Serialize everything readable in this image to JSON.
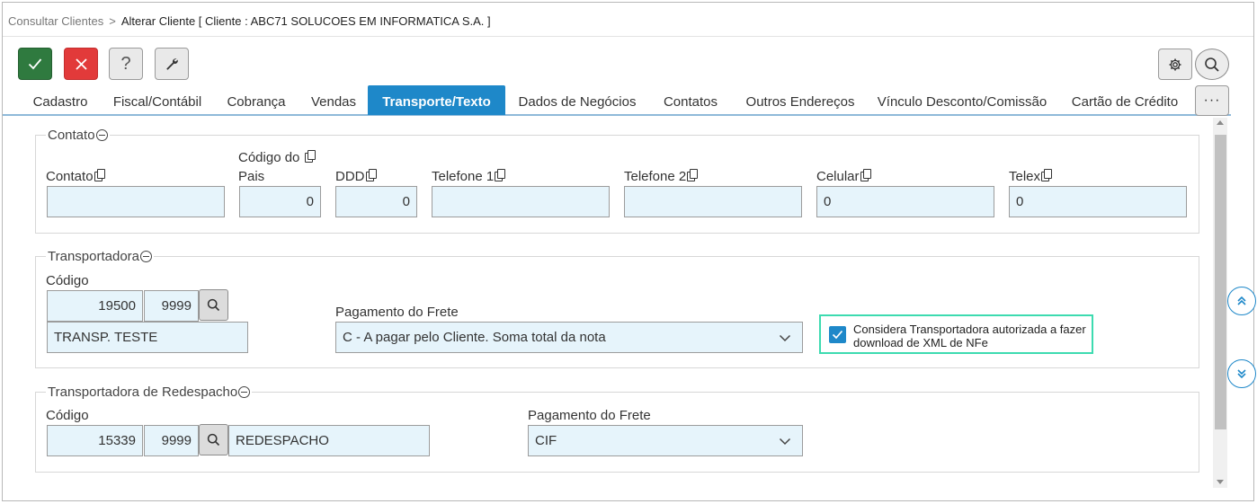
{
  "breadcrumb": {
    "previous": "Consultar Clientes",
    "separator": ">",
    "current": "Alterar Cliente [ Cliente : ABC71 SOLUCOES EM INFORMATICA S.A. ]"
  },
  "toolbar": {
    "help_label": "?",
    "more_label": "···"
  },
  "tabs": [
    {
      "label": "Cadastro",
      "active": false
    },
    {
      "label": "Fiscal/Contábil",
      "active": false
    },
    {
      "label": "Cobrança",
      "active": false
    },
    {
      "label": "Vendas",
      "active": false
    },
    {
      "label": "Transporte/Texto",
      "active": true
    },
    {
      "label": "Dados de Negócios",
      "active": false
    },
    {
      "label": "Contatos",
      "active": false
    },
    {
      "label": "Outros Endereços",
      "active": false
    },
    {
      "label": "Vínculo Desconto/Comissão",
      "active": false
    },
    {
      "label": "Cartão de Crédito",
      "active": false
    }
  ],
  "contato": {
    "legend": "Contato",
    "fields": {
      "contato": {
        "label": "Contato",
        "value": ""
      },
      "codigo_pais": {
        "label_line1": "Código do",
        "label_line2": "Pais",
        "value": "0"
      },
      "ddd": {
        "label": "DDD",
        "value": "0"
      },
      "telefone1": {
        "label": "Telefone 1",
        "value": ""
      },
      "telefone2": {
        "label": "Telefone 2",
        "value": ""
      },
      "celular": {
        "label": "Celular",
        "value": "0"
      },
      "telex": {
        "label": "Telex",
        "value": "0"
      }
    }
  },
  "transportadora": {
    "legend": "Transportadora",
    "codigo_label": "Código",
    "codigo": "19500",
    "codigo_filial": "9999",
    "nome": "TRANSP. TESTE",
    "pagamento_label": "Pagamento do Frete",
    "pagamento_value": "C - A pagar pelo Cliente. Soma total da nota",
    "checkbox_label": "Considera Transportadora autorizada a fazer download de XML de NFe",
    "checkbox_checked": true
  },
  "redespacho": {
    "legend": "Transportadora de Redespacho",
    "codigo_label": "Código",
    "codigo": "15339",
    "codigo_filial": "9999",
    "nome": "REDESPACHO",
    "pagamento_label": "Pagamento do Frete",
    "pagamento_value": "CIF"
  },
  "colors": {
    "accent": "#1e88c9",
    "save": "#2f7a3f",
    "cancel": "#e23a3a",
    "input_bg": "#e6f4fb",
    "highlight_border": "#3ddbb0"
  },
  "icons": {
    "save": "check-icon",
    "cancel": "close-icon",
    "tools": "wrench-icon",
    "config": "gear-icon",
    "search": "search-icon",
    "scroll_up": "double-chevron-up-icon",
    "scroll_down": "double-chevron-down-icon",
    "collapse": "minus-circle-icon",
    "copy": "copy-icon",
    "dropdown": "chevron-down-icon"
  }
}
